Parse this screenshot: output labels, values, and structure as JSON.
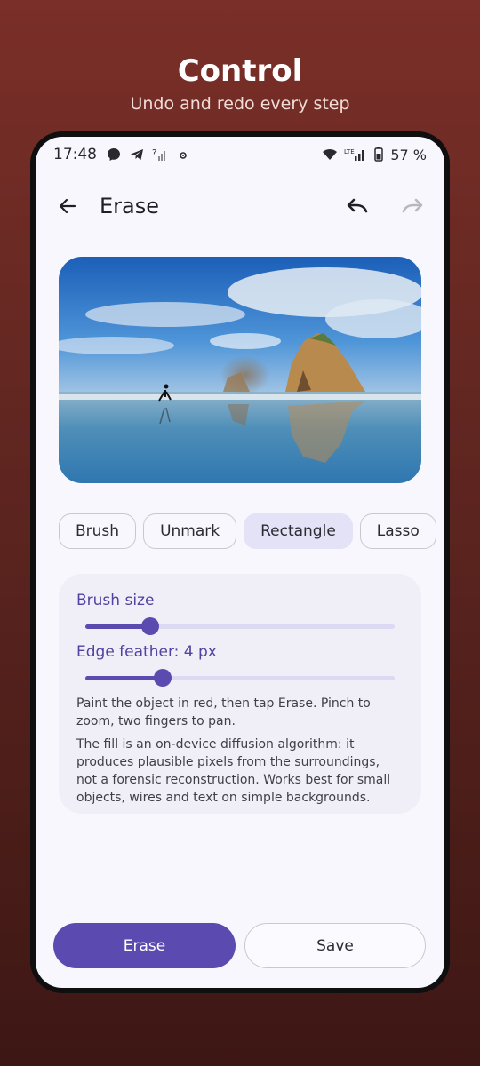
{
  "promo": {
    "title": "Control",
    "subtitle": "Undo and redo every step"
  },
  "status_bar": {
    "time": "17:48",
    "battery": "57 %",
    "network": "LTE",
    "icons": [
      "messenger-icon",
      "telegram-icon",
      "signal-icon",
      "notification-icon",
      "wifi-icon",
      "lte-signal-icon",
      "battery-icon"
    ]
  },
  "app_bar": {
    "title": "Erase",
    "back_icon": "arrow-back-icon",
    "undo_icon": "undo-icon",
    "redo_icon": "redo-icon",
    "redo_enabled": false
  },
  "modes": [
    {
      "label": "Brush",
      "selected": false
    },
    {
      "label": "Unmark",
      "selected": false
    },
    {
      "label": "Rectangle",
      "selected": true
    },
    {
      "label": "Lasso",
      "selected": false
    }
  ],
  "controls": {
    "brush_size_label": "Brush size",
    "brush_size_fraction": 0.21,
    "edge_feather_label": "Edge feather: 4 px",
    "edge_feather_fraction": 0.25,
    "hint": "Paint the object in red, then tap Erase. Pinch to zoom, two fingers to pan.",
    "note": "The fill is an on-device diffusion algorithm: it produces plausible pixels from the surroundings, not a forensic reconstruction. Works best for small objects, wires and text on simple backgrounds."
  },
  "actions": {
    "erase_label": "Erase",
    "save_label": "Save"
  },
  "colors": {
    "accent": "#5b4bb0",
    "chip_selected": "#e3e2f7",
    "background_top": "#7a2f28",
    "background_bottom": "#3d1714"
  }
}
